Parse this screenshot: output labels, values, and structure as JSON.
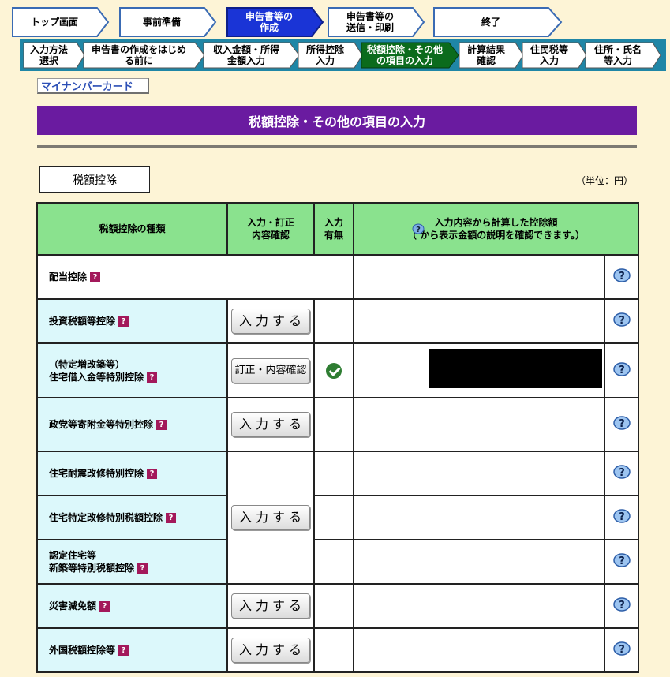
{
  "steps_top": [
    {
      "label": "トップ画面",
      "active": false
    },
    {
      "label": "事前準備",
      "active": false
    },
    {
      "label": "申告書等の\n作成",
      "active": true
    },
    {
      "label": "申告書等の\n送信・印刷",
      "active": false
    },
    {
      "label": "終了",
      "active": false
    }
  ],
  "steps_sub": [
    {
      "label": "入力方法\n選択",
      "active": false
    },
    {
      "label": "申告書の作成をはじめ\nる前に",
      "active": false
    },
    {
      "label": "収入金額・所得\n金額入力",
      "active": false
    },
    {
      "label": "所得控除\n入力",
      "active": false
    },
    {
      "label": "税額控除・その他\nの項目の入力",
      "active": true
    },
    {
      "label": "計算結果\n確認",
      "active": false
    },
    {
      "label": "住民税等\n入力",
      "active": false
    },
    {
      "label": "住所・氏名\n等入力",
      "active": false
    }
  ],
  "mynumber_link": "マイナンバーカード",
  "page_title": "税額控除・その他の項目の入力",
  "section_title": "税額控除",
  "unit": "（単位：円）",
  "table": {
    "headers": {
      "type": "税額控除の種類",
      "action": "入力・訂正\n内容確認",
      "status": "入力\n有無",
      "amount": "入力内容から計算した控除額\n（ から表示金額の説明を確認できます。）"
    },
    "rows": [
      {
        "name": "配当控除"
      },
      {
        "name": "投資税額等控除",
        "button": "入力する"
      },
      {
        "name": "（特定増改築等）\n住宅借入金等特別控除",
        "button": "訂正・内容確認",
        "entered": true
      },
      {
        "name": "政党等寄附金等特別控除",
        "button": "入力する"
      },
      {
        "name": "住宅耐震改修特別控除",
        "button": "入力する"
      },
      {
        "name": "住宅特定改修特別税額控除"
      },
      {
        "name": "認定住宅等\n新築等特別税額控除"
      },
      {
        "name": "災害減免額",
        "button": "入力する"
      },
      {
        "name": "外国税額控除等",
        "button": "入力する"
      }
    ]
  },
  "help_badge": "?",
  "colors": {
    "background": "#fdf4d6",
    "title_purple": "#6a1ba0",
    "active_step": "#1a34d6",
    "active_sub": "#0b6b1c",
    "header_green": "#8ae28e",
    "row_cyan": "#dcf8fb"
  }
}
